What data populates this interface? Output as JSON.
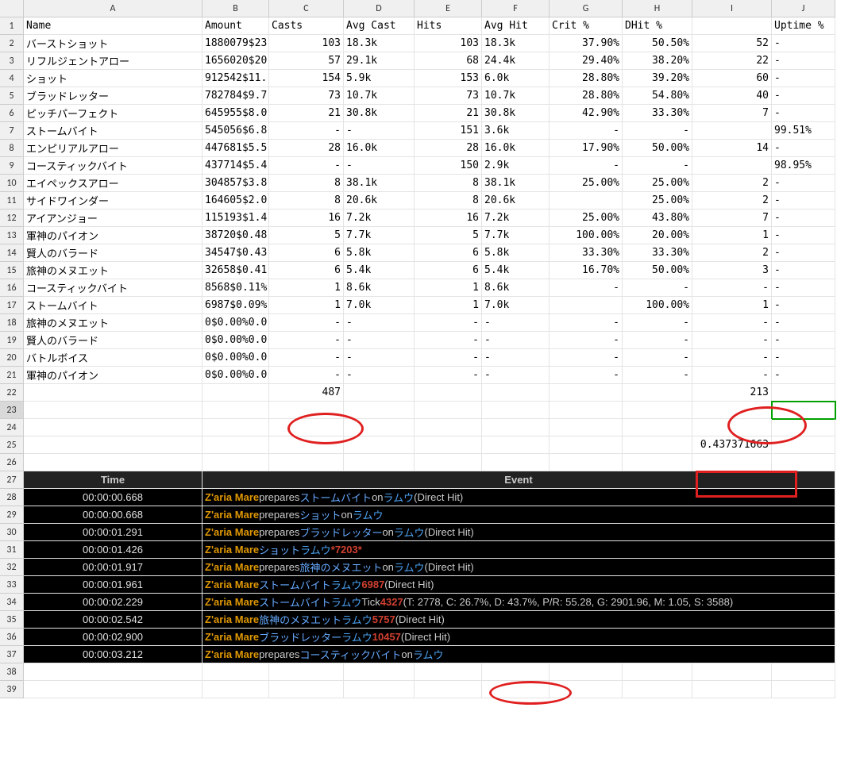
{
  "colHeaders": [
    "",
    "A",
    "B",
    "C",
    "D",
    "E",
    "F",
    "G",
    "H",
    "I",
    "J"
  ],
  "headerRow": [
    "Name",
    "Amount",
    "Casts",
    "Avg Cast",
    "Hits",
    "Avg Hit",
    "Crit %",
    "DHit %",
    "",
    "Uptime %"
  ],
  "rows": [
    {
      "n": "バーストショット",
      "am": "1880079$23",
      "c": "103",
      "ac": "18.3k",
      "h": "103",
      "ah": "18.3k",
      "cr": "37.90%",
      "dh": "50.50%",
      "i": "52",
      "up": "-"
    },
    {
      "n": "リフルジェントアロー",
      "am": "1656020$20",
      "c": "57",
      "ac": "29.1k",
      "h": "68",
      "ah": "24.4k",
      "cr": "29.40%",
      "dh": "38.20%",
      "i": "22",
      "up": "-"
    },
    {
      "n": "ショット",
      "am": "912542$11.",
      "c": "154",
      "ac": "5.9k",
      "h": "153",
      "ah": "6.0k",
      "cr": "28.80%",
      "dh": "39.20%",
      "i": "60",
      "up": "-"
    },
    {
      "n": "ブラッドレッター",
      "am": "782784$9.7",
      "c": "73",
      "ac": "10.7k",
      "h": "73",
      "ah": "10.7k",
      "cr": "28.80%",
      "dh": "54.80%",
      "i": "40",
      "up": "-"
    },
    {
      "n": "ピッチパーフェクト",
      "am": "645955$8.0",
      "c": "21",
      "ac": "30.8k",
      "h": "21",
      "ah": "30.8k",
      "cr": "42.90%",
      "dh": "33.30%",
      "i": "7",
      "up": "-"
    },
    {
      "n": "ストームバイト",
      "am": "545056$6.8",
      "c": "-",
      "ac": "-",
      "h": "151",
      "ah": "3.6k",
      "cr": "-",
      "dh": "-",
      "i": "",
      "up": "99.51%"
    },
    {
      "n": "エンピリアルアロー",
      "am": "447681$5.5",
      "c": "28",
      "ac": "16.0k",
      "h": "28",
      "ah": "16.0k",
      "cr": "17.90%",
      "dh": "50.00%",
      "i": "14",
      "up": "-"
    },
    {
      "n": "コースティックバイト",
      "am": "437714$5.4",
      "c": "-",
      "ac": "-",
      "h": "150",
      "ah": "2.9k",
      "cr": "-",
      "dh": "-",
      "i": "",
      "up": "98.95%"
    },
    {
      "n": "エイペックスアロー",
      "am": "304857$3.8",
      "c": "8",
      "ac": "38.1k",
      "h": "8",
      "ah": "38.1k",
      "cr": "25.00%",
      "dh": "25.00%",
      "i": "2",
      "up": "-"
    },
    {
      "n": "サイドワインダー",
      "am": "164605$2.0",
      "c": "8",
      "ac": "20.6k",
      "h": "8",
      "ah": "20.6k",
      "cr": "",
      "dh": "25.00%",
      "i": "2",
      "up": "-"
    },
    {
      "n": "アイアンジョー",
      "am": "115193$1.4",
      "c": "16",
      "ac": "7.2k",
      "h": "16",
      "ah": "7.2k",
      "cr": "25.00%",
      "dh": "43.80%",
      "i": "7",
      "up": "-"
    },
    {
      "n": "軍神のパイオン",
      "am": "38720$0.48",
      "c": "5",
      "ac": "7.7k",
      "h": "5",
      "ah": "7.7k",
      "cr": "100.00%",
      "dh": "20.00%",
      "i": "1",
      "up": "-"
    },
    {
      "n": "賢人のバラード",
      "am": "34547$0.43",
      "c": "6",
      "ac": "5.8k",
      "h": "6",
      "ah": "5.8k",
      "cr": "33.30%",
      "dh": "33.30%",
      "i": "2",
      "up": "-"
    },
    {
      "n": "旅神のメヌエット",
      "am": "32658$0.41",
      "c": "6",
      "ac": "5.4k",
      "h": "6",
      "ah": "5.4k",
      "cr": "16.70%",
      "dh": "50.00%",
      "i": "3",
      "up": "-"
    },
    {
      "n": "コースティックバイト",
      "am": "8568$0.11%",
      "c": "1",
      "ac": "8.6k",
      "h": "1",
      "ah": "8.6k",
      "cr": "-",
      "dh": "-",
      "i": "-",
      "up": "-"
    },
    {
      "n": "ストームバイト",
      "am": "6987$0.09%",
      "c": "1",
      "ac": "7.0k",
      "h": "1",
      "ah": "7.0k",
      "cr": "",
      "dh": "100.00%",
      "i": "1",
      "up": "-"
    },
    {
      "n": "旅神のメヌエット",
      "am": "0$0.00%0.0",
      "c": "-",
      "ac": "-",
      "h": "-",
      "ah": "-",
      "cr": "-",
      "dh": "-",
      "i": "-",
      "up": "-"
    },
    {
      "n": "賢人のバラード",
      "am": "0$0.00%0.0",
      "c": "-",
      "ac": "-",
      "h": "-",
      "ah": "-",
      "cr": "-",
      "dh": "-",
      "i": "-",
      "up": "-"
    },
    {
      "n": "バトルボイス",
      "am": "0$0.00%0.0",
      "c": "-",
      "ac": "-",
      "h": "-",
      "ah": "-",
      "cr": "-",
      "dh": "-",
      "i": "-",
      "up": "-"
    },
    {
      "n": "軍神のパイオン",
      "am": "0$0.00%0.0",
      "c": "-",
      "ac": "-",
      "h": "-",
      "ah": "-",
      "cr": "-",
      "dh": "-",
      "i": "-",
      "up": "-"
    }
  ],
  "sumRow": {
    "c": "487",
    "i": "213"
  },
  "calcCell": "0.437371663",
  "logHeaders": {
    "time": "Time",
    "event": "Event"
  },
  "log": [
    {
      "t": "00:00:00.668",
      "actor": "Z'aria Mare",
      "verb": "prepares",
      "ability": "ストームバイト",
      "conn": "on",
      "target": "ラムウ",
      "tail": "(Direct Hit)"
    },
    {
      "t": "00:00:00.668",
      "actor": "Z'aria Mare",
      "verb": "prepares",
      "ability": "ショット",
      "conn": "on",
      "target": "ラムウ",
      "tail": ""
    },
    {
      "t": "00:00:01.291",
      "actor": "Z'aria Mare",
      "verb": "prepares",
      "ability": "ブラッドレッター",
      "conn": "on",
      "target": "ラムウ",
      "tail": "(Direct Hit)"
    },
    {
      "t": "00:00:01.426",
      "actor": "Z'aria Mare",
      "verb": "",
      "ability": "ショット",
      "conn": "",
      "target": "ラムウ",
      "dmg": "*7203*",
      "tail": ""
    },
    {
      "t": "00:00:01.917",
      "actor": "Z'aria Mare",
      "verb": "prepares",
      "ability": "旅神のメヌエット",
      "conn": "on",
      "target": "ラムウ",
      "tail": "(Direct Hit)"
    },
    {
      "t": "00:00:01.961",
      "actor": "Z'aria Mare",
      "verb": "",
      "ability": "ストームバイト",
      "conn": "",
      "target": "ラムウ",
      "dmg": "6987",
      "tail": "(Direct Hit)"
    },
    {
      "t": "00:00:02.229",
      "actor": "Z'aria Mare",
      "verb": "",
      "ability": "ストームバイト",
      "conn": "",
      "target": "ラムウ",
      "tick": "Tick",
      "dmg": "4327",
      "tail": "(T: 2778, C: 26.7%, D: 43.7%, P/R: 55.28, G: 2901.96, M: 1.05, S: 3588)"
    },
    {
      "t": "00:00:02.542",
      "actor": "Z'aria Mare",
      "verb": "",
      "ability": "旅神のメヌエット",
      "conn": "",
      "target": "ラムウ",
      "dmg": "5757",
      "tail": "(Direct Hit)"
    },
    {
      "t": "00:00:02.900",
      "actor": "Z'aria Mare",
      "verb": "",
      "ability": "ブラッドレッター",
      "conn": "",
      "target": "ラムウ",
      "dmg": "10457",
      "tail": "(Direct Hit)"
    },
    {
      "t": "00:00:03.212",
      "actor": "Z'aria Mare",
      "verb": "prepares",
      "ability": "コースティックバイト",
      "conn": "on",
      "target": "ラムウ",
      "tail": ""
    }
  ],
  "annotations": {
    "circle_col_c": true,
    "circle_col_i": true,
    "box_calc": true,
    "circle_tick": true
  }
}
